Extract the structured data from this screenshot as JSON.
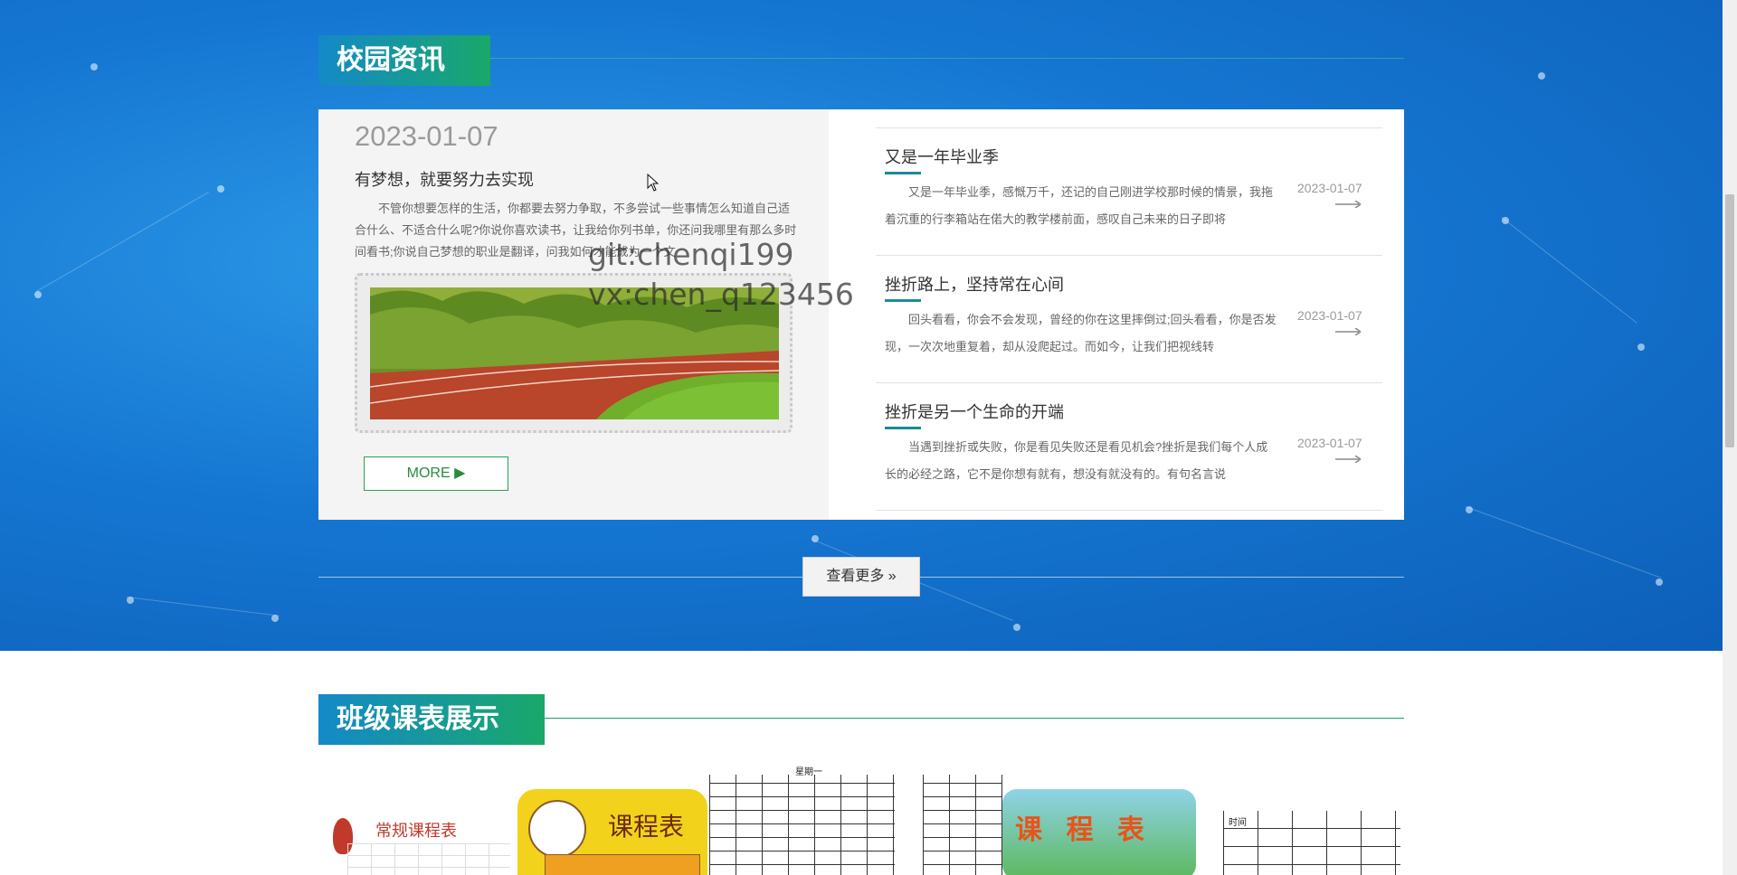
{
  "news_section": {
    "title": "校园资讯",
    "featured": {
      "date": "2023-01-07",
      "title": "有梦想，就要努力去实现",
      "excerpt": "不管你想要怎样的生活，你都要去努力争取，不多尝试一些事情怎么知道自己适合什么、不适合什么呢?你说你喜欢读书，让我给你列书单，你还问我哪里有那么多时间看书;你说自己梦想的职业是翻译，问我如何才能成为一个文",
      "more_label": "MORE ▶"
    },
    "items": [
      {
        "title": "又是一年毕业季",
        "excerpt": "又是一年毕业季，感慨万千，还记的自己刚进学校那时候的情景，我拖着沉重的行李箱站在偌大的教学楼前面，感叹自己未来的日子即将",
        "date": "2023-01-07"
      },
      {
        "title": "挫折路上，坚持常在心间",
        "excerpt": "回头看看，你会不会发现，曾经的你在这里摔倒过;回头看看，你是否发现，一次次地重复着，却从没爬起过。而如今，让我们把视线转",
        "date": "2023-01-07"
      },
      {
        "title": "挫折是另一个生命的开端",
        "excerpt": "当遇到挫折或失败，你是看见失败还是看见机会?挫折是我们每个人成长的必经之路，它不是你想有就有，想没有就没有的。有句名言说",
        "date": "2023-01-07"
      }
    ],
    "see_more_label": "查看更多 »"
  },
  "watermark": {
    "line1": "git:chenqi199",
    "line2": "vx:chen_q123456"
  },
  "schedule_section": {
    "title": "班级课表展示",
    "images": [
      {
        "caption": "常规课程表"
      },
      {
        "caption": "课程表"
      },
      {
        "caption": "星期一"
      },
      {
        "caption": "课 程 表"
      },
      {
        "caption": "时间"
      }
    ]
  },
  "colors": {
    "accent_blue": "#1489c9",
    "accent_green": "#19a86a",
    "band_blue": "#1577d2"
  }
}
